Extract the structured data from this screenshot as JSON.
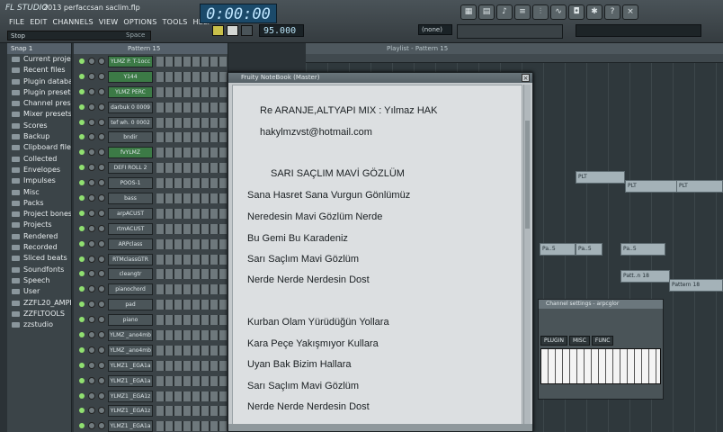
{
  "app": {
    "logo": "FL STUDIO",
    "project_title": "2013 perfaccsan saclim.flp",
    "menu": [
      "FILE",
      "EDIT",
      "CHANNELS",
      "VIEW",
      "OPTIONS",
      "TOOLS",
      "HELP"
    ],
    "hint": "Stop",
    "hint_right": "Space",
    "time_display": "0:00:00",
    "tempo": "95.000",
    "pattern_selector": "(none)"
  },
  "browser": {
    "header": "Snap 1",
    "items": [
      "Current project",
      "Recent files",
      "Plugin database",
      "Plugin presets",
      "Channel presets",
      "Mixer presets",
      "Scores",
      "Backup",
      "Clipboard files",
      "Collected",
      "Envelopes",
      "Impulses",
      "Misc",
      "Packs",
      "Project bones",
      "Projects",
      "Rendered",
      "Recorded",
      "Sliced beats",
      "Soundfonts",
      "Speech",
      "User",
      "ZZFL20_AMPLE",
      "ZZFLTOOLS",
      "zzstudio"
    ]
  },
  "channel_rack": {
    "header": "Pattern 15",
    "channels": [
      {
        "name": "YLMZ P. T-1occ",
        "green": true
      },
      {
        "name": "Y144",
        "green": true
      },
      {
        "name": "YLMZ PERC",
        "green": true
      },
      {
        "name": "darbuk 0 0009",
        "green": false
      },
      {
        "name": "tef wh. 0 0002",
        "green": false
      },
      {
        "name": "bndir",
        "green": false
      },
      {
        "name": "fvYLMZ",
        "green": true
      },
      {
        "name": "DEFI ROLL 2",
        "green": false
      },
      {
        "name": "POOS-1",
        "green": false
      },
      {
        "name": "bass",
        "green": false
      },
      {
        "name": "arpACUST",
        "green": false
      },
      {
        "name": "rtmACUST",
        "green": false
      },
      {
        "name": "ARPclass",
        "green": false
      },
      {
        "name": "RTMclassGTR",
        "green": false
      },
      {
        "name": "cleangtr",
        "green": false
      },
      {
        "name": "pianochord",
        "green": false
      },
      {
        "name": "pad",
        "green": false
      },
      {
        "name": "piano",
        "green": false
      },
      {
        "name": "YLMZ _ano4mb",
        "green": false
      },
      {
        "name": "YLMZ _ano4mb",
        "green": false
      },
      {
        "name": "YLMZ1 _EGA1a",
        "green": false
      },
      {
        "name": "YLMZ1 _EGA1a",
        "green": false
      },
      {
        "name": "YLMZ1 _EGA1z",
        "green": false
      },
      {
        "name": "YLMZ1 _EGA1z",
        "green": false
      },
      {
        "name": "YLMZ1 _EGA1a",
        "green": false
      }
    ]
  },
  "playlist": {
    "title": "Playlist - Pattern 15",
    "clips": [
      {
        "label": "PLT"
      },
      {
        "label": "PLT"
      },
      {
        "label": "PLT"
      },
      {
        "label": "Pa..5"
      },
      {
        "label": "Pa..5"
      },
      {
        "label": "Pa..5"
      },
      {
        "label": "Patt..n 18"
      },
      {
        "label": "Pattern 18"
      }
    ]
  },
  "channel_settings": {
    "title": "Channel settings - arpcglor",
    "tabs": [
      "PLUGIN",
      "MISC",
      "FUNC"
    ]
  },
  "notebook": {
    "title": "Fruity NoteBook (Master)",
    "lines": [
      "Re ARANJE,ALTYAPI MIX : Yılmaz HAK",
      "hakylmzvst@hotmail.com",
      "SARI SAÇLIM MAVİ GÖZLÜM",
      "Sana Hasret Sana Vurgun Gönlümüz",
      "Neredesin Mavi Gözlüm  Nerde",
      "Bu Gemi Bu Karadeniz",
      "Sarı Saçlım Mavi Gözlüm",
      "Nerde Nerde Nerdesin Dost",
      "Kurban Olam Yürüdüğün Yollara",
      "Kara Peçe Yakışmıyor Kullara",
      "Uyan Bak Bizim Hallara",
      "Sarı Saçlım Mavi Gözlüm",
      "Nerde Nerde Nerdesin Dost"
    ]
  }
}
